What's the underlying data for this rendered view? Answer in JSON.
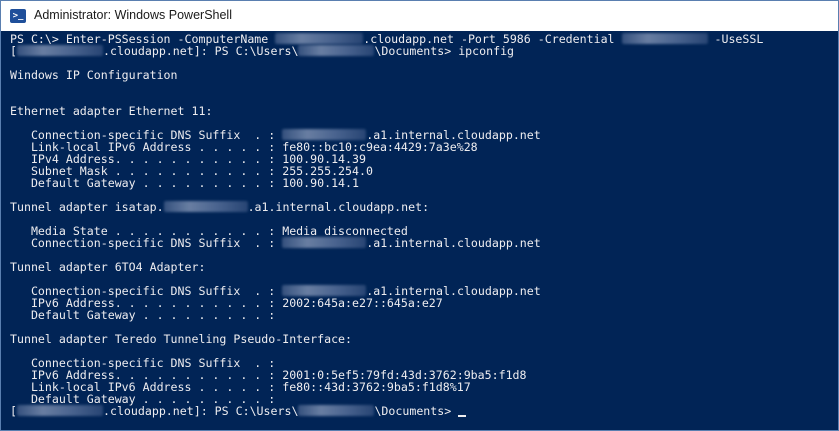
{
  "window": {
    "title": "Administrator: Windows PowerShell",
    "icon": "powershell-icon",
    "background": "#012456",
    "foreground": "#eeedf0"
  },
  "console": {
    "l1a": "PS C:\\> Enter-PSSession -ComputerName ",
    "l1b": ".cloudapp.net -Port 5986 -Credential ",
    "l1c": " -UseSSL",
    "l2a": "[",
    "l2b": ".cloudapp.net]: PS C:\\Users\\",
    "l2c": "\\Documents> ipconfig",
    "l3": "Windows IP Configuration",
    "l4": "Ethernet adapter Ethernet 11:",
    "l5a": "   Connection-specific DNS Suffix  . : ",
    "l5b": ".a1.internal.cloudapp.net",
    "l6": "   Link-local IPv6 Address . . . . . : fe80::bc10:c9ea:4429:7a3e%28",
    "l7": "   IPv4 Address. . . . . . . . . . . : 100.90.14.39",
    "l8": "   Subnet Mask . . . . . . . . . . . : 255.255.254.0",
    "l9": "   Default Gateway . . . . . . . . . : 100.90.14.1",
    "l10a": "Tunnel adapter isatap.",
    "l10b": ".a1.internal.cloudapp.net:",
    "l11": "   Media State . . . . . . . . . . . : Media disconnected",
    "l12a": "   Connection-specific DNS Suffix  . : ",
    "l12b": ".a1.internal.cloudapp.net",
    "l13": "Tunnel adapter 6TO4 Adapter:",
    "l14a": "   Connection-specific DNS Suffix  . : ",
    "l14b": ".a1.internal.cloudapp.net",
    "l15": "   IPv6 Address. . . . . . . . . . . : 2002:645a:e27::645a:e27",
    "l16": "   Default Gateway . . . . . . . . . :",
    "l17": "Tunnel adapter Teredo Tunneling Pseudo-Interface:",
    "l18": "   Connection-specific DNS Suffix  . :",
    "l19": "   IPv6 Address. . . . . . . . . . . : 2001:0:5ef5:79fd:43d:3762:9ba5:f1d8",
    "l20": "   Link-local IPv6 Address . . . . . : fe80::43d:3762:9ba5:f1d8%17",
    "l21": "   Default Gateway . . . . . . . . . :",
    "l22a": "[",
    "l22b": ".cloudapp.net]: PS C:\\Users\\",
    "l22c": "\\Documents> "
  }
}
